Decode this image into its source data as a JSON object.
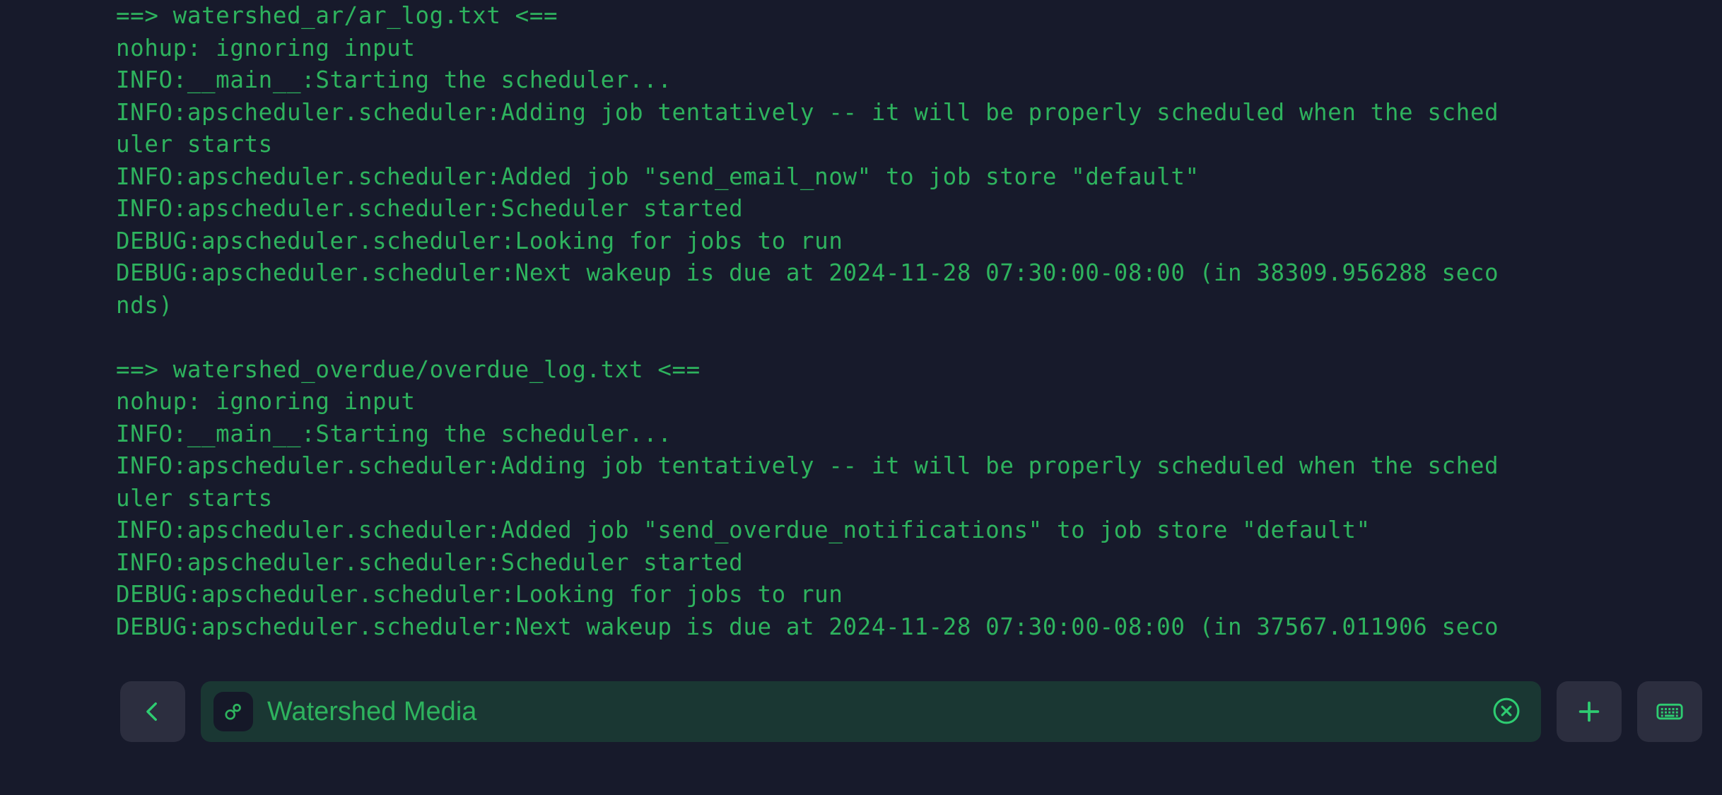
{
  "terminal": {
    "lines": [
      "==> watershed_ar/ar_log.txt <==",
      "nohup: ignoring input",
      "INFO:__main__:Starting the scheduler...",
      "INFO:apscheduler.scheduler:Adding job tentatively -- it will be properly scheduled when the sched",
      "uler starts",
      "INFO:apscheduler.scheduler:Added job \"send_email_now\" to job store \"default\"",
      "INFO:apscheduler.scheduler:Scheduler started",
      "DEBUG:apscheduler.scheduler:Looking for jobs to run",
      "DEBUG:apscheduler.scheduler:Next wakeup is due at 2024-11-28 07:30:00-08:00 (in 38309.956288 seco",
      "nds)",
      "",
      "==> watershed_overdue/overdue_log.txt <==",
      "nohup: ignoring input",
      "INFO:__main__:Starting the scheduler...",
      "INFO:apscheduler.scheduler:Adding job tentatively -- it will be properly scheduled when the sched",
      "uler starts",
      "INFO:apscheduler.scheduler:Added job \"send_overdue_notifications\" to job store \"default\"",
      "INFO:apscheduler.scheduler:Scheduler started",
      "DEBUG:apscheduler.scheduler:Looking for jobs to run",
      "DEBUG:apscheduler.scheduler:Next wakeup is due at 2024-11-28 07:30:00-08:00 (in 37567.011906 seco"
    ]
  },
  "toolbar": {
    "back_label": "chevron-left-icon",
    "session_icon": "link-session-icon",
    "session_name": "Watershed Media",
    "close_label": "close-circle-icon",
    "add_label": "plus-icon",
    "keyboard_label": "keyboard-icon"
  },
  "colors": {
    "background": "#171a2b",
    "terminal_text": "#2eb35e",
    "session_field_bg": "#1a3733",
    "button_bg": "#2c2e3f",
    "accent": "#2eb35e"
  }
}
